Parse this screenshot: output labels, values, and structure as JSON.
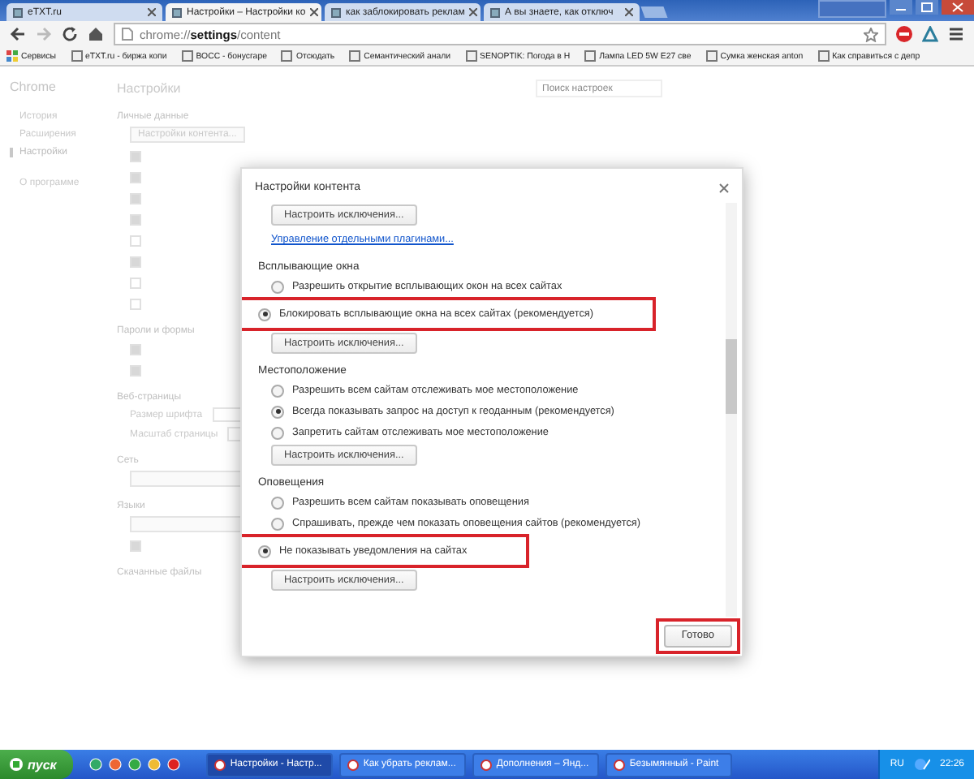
{
  "browser": {
    "tabs": [
      {
        "title": "eTXT.ru",
        "selected": false
      },
      {
        "title": "Настройки – Настройки ко",
        "selected": true
      },
      {
        "title": "как заблокировать реклам",
        "selected": false
      },
      {
        "title": "А вы знаете, как отключ",
        "selected": false
      }
    ],
    "address": "chrome://**settings**/content",
    "bookmarks": [
      {
        "label": "Сервисы"
      },
      {
        "label": "eTXT.ru - биржа копи"
      },
      {
        "label": "ВОСС - бонусгаре"
      },
      {
        "label": "Отсюдать"
      },
      {
        "label": "Семантический анали"
      },
      {
        "label": "SENOPTIK: Погода в Н"
      },
      {
        "label": "Лампа LED 5W E27 све"
      },
      {
        "label": "Сумка женская anton"
      },
      {
        "label": "Как справиться с депр"
      }
    ]
  },
  "settings_page": {
    "brand": "Chrome",
    "title": "Настройки",
    "search": {
      "placeholder": "Поиск настроек"
    },
    "sidebar": [
      {
        "label": "История",
        "selected": false
      },
      {
        "label": "Расширения",
        "selected": false
      },
      {
        "label": "Настройки",
        "selected": true
      },
      {
        "label": "О программе",
        "selected": false
      }
    ],
    "sections": [
      {
        "heading": "Личные данные",
        "items": [
          {
            "kind": "button",
            "label": "Настройки контента..."
          },
          {
            "kind": "check",
            "checked": true
          },
          {
            "kind": "check",
            "checked": true
          },
          {
            "kind": "check",
            "checked": true
          },
          {
            "kind": "check",
            "checked": true
          },
          {
            "kind": "check",
            "checked": false
          },
          {
            "kind": "check",
            "checked": true
          },
          {
            "kind": "check",
            "checked": false
          },
          {
            "kind": "check",
            "checked": false
          }
        ]
      },
      {
        "heading": "Пароли и формы",
        "items": [
          {
            "kind": "check",
            "checked": true
          },
          {
            "kind": "check",
            "checked": true
          }
        ]
      },
      {
        "heading": "Веб-страницы",
        "items": [
          {
            "kind": "select",
            "label": "Размер шрифта"
          },
          {
            "kind": "select",
            "label": "Масштаб страницы"
          }
        ]
      },
      {
        "heading": "Сеть",
        "items": [
          {
            "kind": "button"
          }
        ]
      },
      {
        "heading": "Языки",
        "items": [
          {
            "kind": "button"
          },
          {
            "kind": "check",
            "checked": true
          }
        ]
      },
      {
        "heading": "Скачанные файлы"
      }
    ]
  },
  "dialog": {
    "title": "Настройки контента",
    "sections": [
      {
        "items": [
          {
            "kind": "button",
            "label": "Настроить исключения..."
          },
          {
            "kind": "link",
            "label": "Управление отдельными плагинами..."
          }
        ]
      },
      {
        "heading": "Всплывающие окна",
        "items": [
          {
            "kind": "radio",
            "label": "Разрешить открытие всплывающих окон на всех сайтах",
            "selected": false,
            "highlighted": false
          },
          {
            "kind": "radio",
            "label": "Блокировать всплывающие окна на всех сайтах (рекомендуется)",
            "selected": true,
            "highlighted": true
          },
          {
            "kind": "button",
            "label": "Настроить исключения..."
          }
        ]
      },
      {
        "heading": "Местоположение",
        "items": [
          {
            "kind": "radio",
            "label": "Разрешить всем сайтам отслеживать мое местоположение",
            "selected": false,
            "highlighted": false
          },
          {
            "kind": "radio",
            "label": "Всегда показывать запрос на доступ к геоданным (рекомендуется)",
            "selected": true,
            "highlighted": false
          },
          {
            "kind": "radio",
            "label": "Запретить сайтам отслеживать мое местоположение",
            "selected": false,
            "highlighted": false
          },
          {
            "kind": "button",
            "label": "Настроить исключения..."
          }
        ]
      },
      {
        "heading": "Оповещения",
        "items": [
          {
            "kind": "radio",
            "label": "Разрешить всем сайтам показывать оповещения",
            "selected": false,
            "highlighted": false
          },
          {
            "kind": "radio",
            "label": "Спрашивать, прежде чем показать оповещения сайтов (рекомендуется)",
            "selected": false,
            "highlighted": false
          },
          {
            "kind": "radio",
            "label": "Не показывать уведомления на сайтах",
            "selected": true,
            "highlighted": true
          },
          {
            "kind": "button",
            "label": "Настроить исключения..."
          }
        ]
      }
    ],
    "done_button": {
      "label": "Готово",
      "highlighted": true
    }
  },
  "taskbar": {
    "start": "пуск",
    "tasks": [
      {
        "label": "Настройки - Настр...",
        "selected": true
      },
      {
        "label": "Как убрать реклам...",
        "selected": false
      },
      {
        "label": "Дополнения – Янд...",
        "selected": false
      },
      {
        "label": "Безымянный - Paint",
        "selected": false
      }
    ],
    "language": "RU",
    "clock": "22:26"
  }
}
